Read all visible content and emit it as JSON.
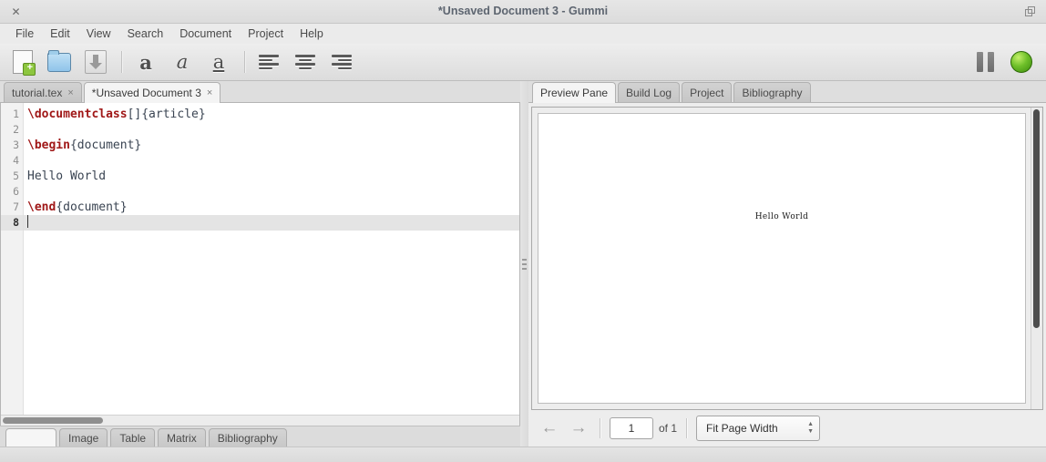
{
  "window": {
    "title": "*Unsaved Document 3 - Gummi",
    "close_icon": "close-icon",
    "maximize_icon": "maximize-icon"
  },
  "menu": {
    "items": [
      {
        "label": "File"
      },
      {
        "label": "Edit"
      },
      {
        "label": "View"
      },
      {
        "label": "Search"
      },
      {
        "label": "Document"
      },
      {
        "label": "Project"
      },
      {
        "label": "Help"
      }
    ]
  },
  "toolbar": {
    "new_document": "new-document-icon",
    "open_document": "open-folder-icon",
    "save_document": "save-down-arrow-icon",
    "bold_label": "a",
    "italic_label": "a",
    "underline_label": "a",
    "align_left": "align-left-icon",
    "align_center": "align-center-icon",
    "align_right": "align-right-icon",
    "pause_icon": "pause-icon",
    "status_led": "green-status-circle",
    "led_color": "#6fc02a"
  },
  "editor": {
    "tabs": [
      {
        "label": "tutorial.tex",
        "close": "×",
        "active": false
      },
      {
        "label": "*Unsaved Document 3",
        "close": "×",
        "active": true
      }
    ],
    "line_numbers": [
      "1",
      "2",
      "3",
      "4",
      "5",
      "6",
      "7",
      "8"
    ],
    "current_line": 8,
    "lines": [
      {
        "number": "1",
        "command": "\\documentclass",
        "text": "[]{article}"
      },
      {
        "number": "2",
        "command": "",
        "text": ""
      },
      {
        "number": "3",
        "command": "\\begin",
        "text": "{document}"
      },
      {
        "number": "4",
        "command": "",
        "text": ""
      },
      {
        "number": "5",
        "command": "",
        "text": "Hello World"
      },
      {
        "number": "6",
        "command": "",
        "text": ""
      },
      {
        "number": "7",
        "command": "\\end",
        "text": "{document}"
      },
      {
        "number": "8",
        "command": "",
        "text": ""
      }
    ],
    "command_color": "#a01818",
    "text_color": "#3a4452",
    "bottom_tabs": [
      {
        "label": "",
        "active": true
      },
      {
        "label": "Image",
        "active": false
      },
      {
        "label": "Table",
        "active": false
      },
      {
        "label": "Matrix",
        "active": false
      },
      {
        "label": "Bibliography",
        "active": false
      }
    ]
  },
  "preview": {
    "tabs": [
      {
        "label": "Preview Pane",
        "active": true
      },
      {
        "label": "Build Log",
        "active": false
      },
      {
        "label": "Project",
        "active": false
      },
      {
        "label": "Bibliography",
        "active": false
      }
    ],
    "page_text": "Hello World",
    "controls": {
      "prev_icon": "arrow-left-icon",
      "next_icon": "arrow-right-icon",
      "page_number": "1",
      "page_total": "of 1",
      "zoom_value": "Fit Page Width",
      "spinner_up": "▲",
      "spinner_down": "▼"
    }
  }
}
